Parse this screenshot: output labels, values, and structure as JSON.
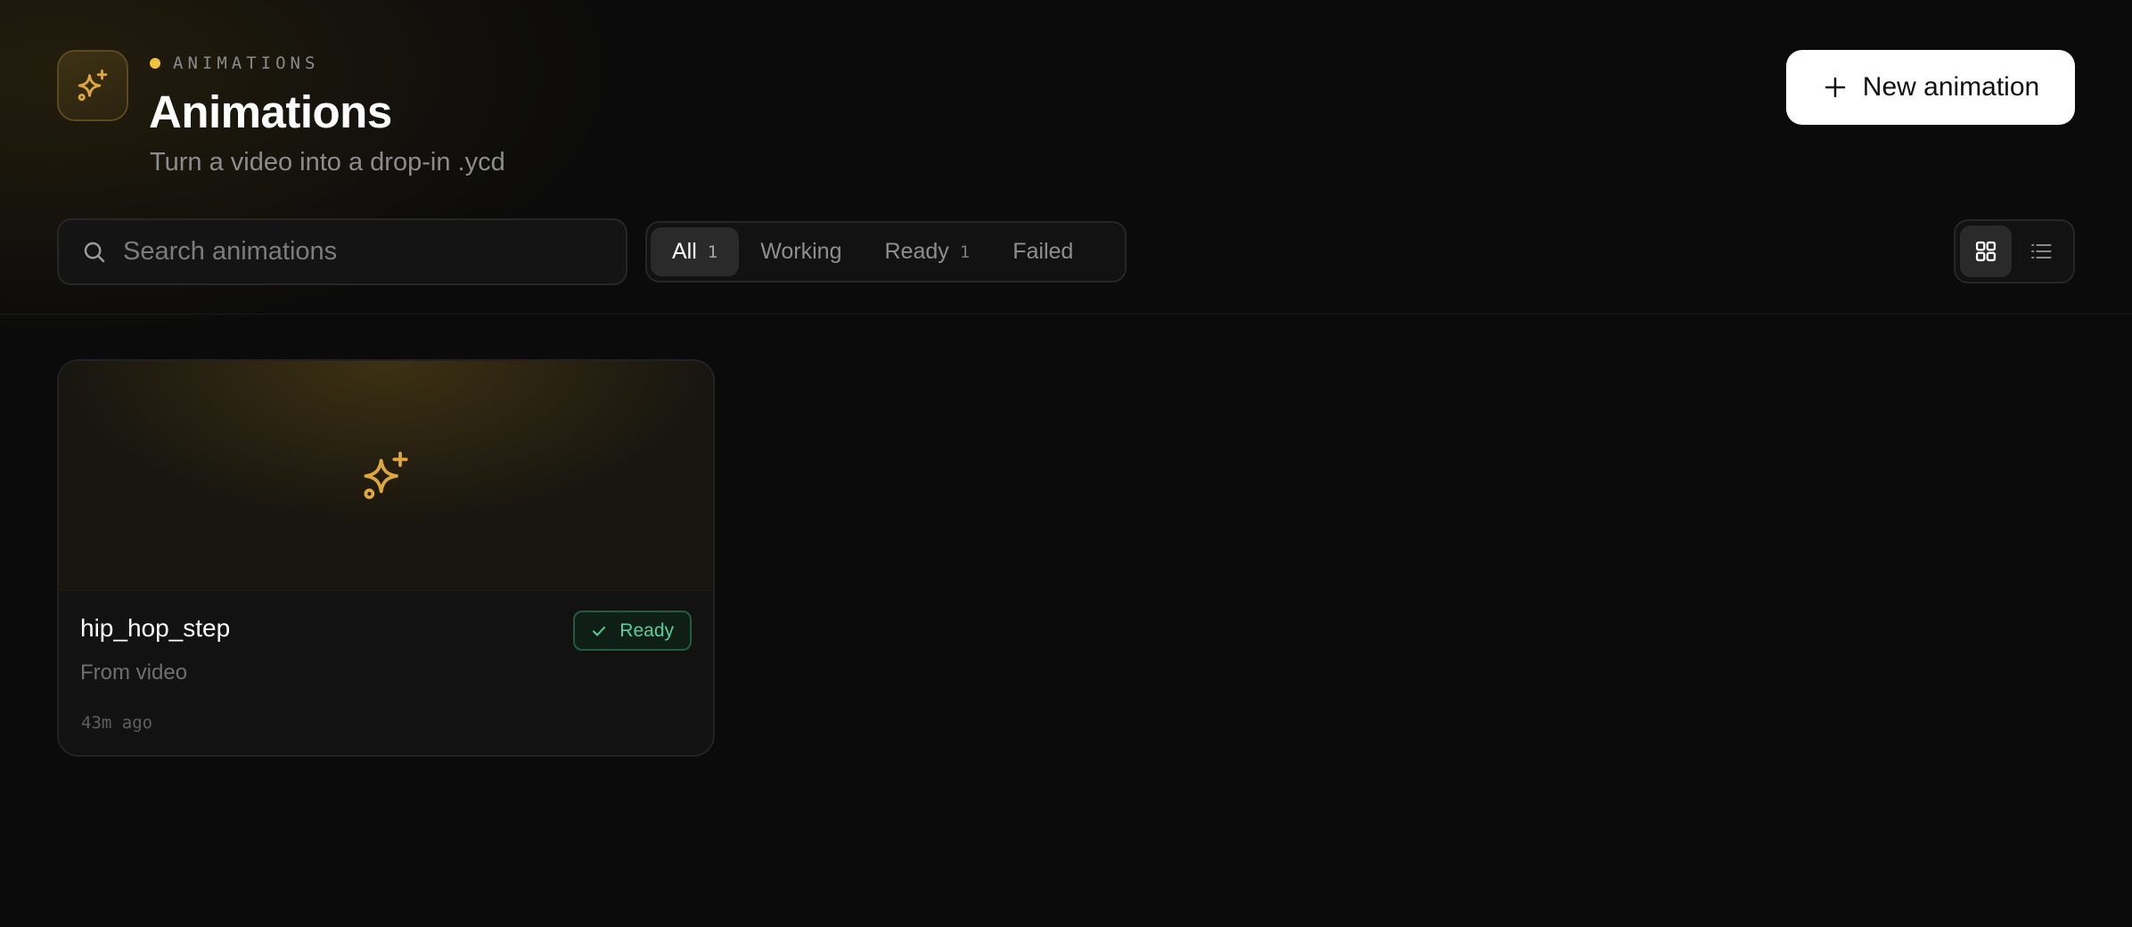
{
  "header": {
    "eyebrow": "ANIMATIONS",
    "title": "Animations",
    "subtitle": "Turn a video into a drop-in .ycd",
    "new_button_label": "New animation",
    "logo_icon": "sparkles-icon"
  },
  "toolbar": {
    "search_placeholder": "Search animations",
    "search_value": "",
    "filters": [
      {
        "label": "All",
        "count": "1",
        "active": true
      },
      {
        "label": "Working",
        "count": "",
        "active": false
      },
      {
        "label": "Ready",
        "count": "1",
        "active": false
      },
      {
        "label": "Failed",
        "count": "",
        "active": false
      }
    ],
    "view_modes": [
      {
        "icon": "grid-view-icon",
        "active": true
      },
      {
        "icon": "list-view-icon",
        "active": false
      }
    ]
  },
  "cards": [
    {
      "name": "hip_hop_step",
      "status": "Ready",
      "source": "From video",
      "time": "43m ago",
      "thumb_icon": "sparkles-icon"
    }
  ],
  "colors": {
    "accent": "#f2c233",
    "icon_gold": "#e0a935",
    "ready_green": "#4fd39a",
    "background": "#0b0b0b"
  }
}
